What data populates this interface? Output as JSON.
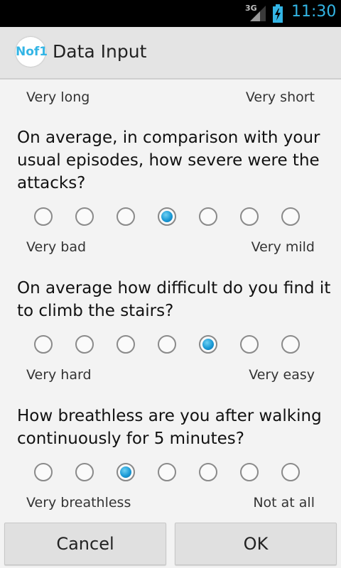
{
  "status_bar": {
    "network": "3G",
    "time": "11:30"
  },
  "action_bar": {
    "logo_text": "Nof1",
    "title": "Data Input"
  },
  "questions": [
    {
      "scale_low": "Very long",
      "scale_high": "Very short"
    },
    {
      "text": "On average, in comparison with your usual episodes, how severe were the attacks?",
      "options": 7,
      "selected": 3,
      "scale_low": "Very bad",
      "scale_high": "Very mild"
    },
    {
      "text": "On average how difficult do you find it to climb the stairs?",
      "options": 7,
      "selected": 4,
      "scale_low": "Very hard",
      "scale_high": "Very easy"
    },
    {
      "text": "How breathless are you after walking continuously for 5 minutes?",
      "options": 7,
      "selected": 2,
      "scale_low": "Very breathless",
      "scale_high": "Not at all"
    }
  ],
  "buttons": {
    "cancel": "Cancel",
    "ok": "OK"
  },
  "colors": {
    "accent": "#33b5e5",
    "radio_selected": "#1a9ad6"
  }
}
